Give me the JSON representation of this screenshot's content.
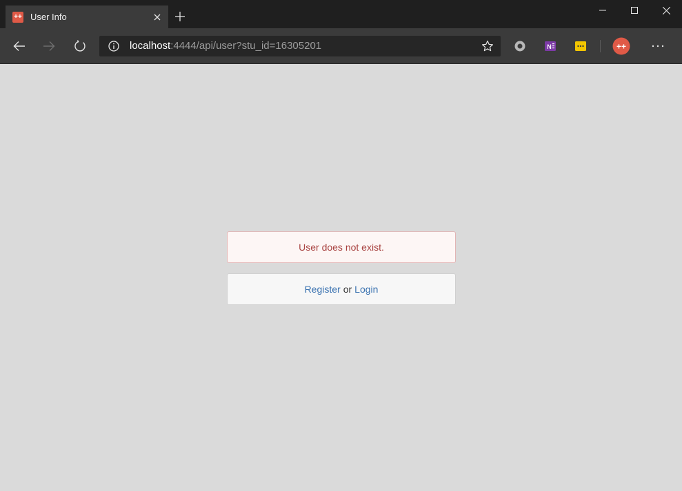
{
  "tab": {
    "title": "User Info",
    "favicon": "++"
  },
  "address": {
    "host": "localhost",
    "rest": ":4444/api/user?stu_id=16305201"
  },
  "extensions": {
    "avatar_label": "++",
    "onenote_label": "N"
  },
  "content": {
    "alert_text": "User does not exist.",
    "register_label": "Register",
    "or_text": "or",
    "login_label": "Login"
  },
  "colors": {
    "accent_red": "#e05a47",
    "link": "#3a72b0",
    "alert_text": "#a94442"
  }
}
